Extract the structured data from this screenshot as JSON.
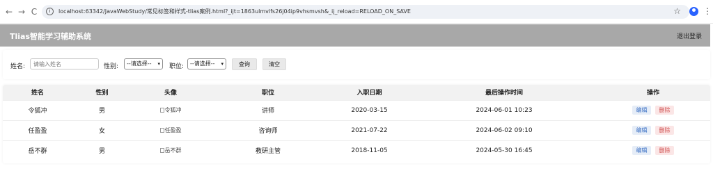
{
  "browser": {
    "url": "localhost:63342/JavaWebStudy/常见标签和样式-tlias案例.html?_ijt=1863ulmvlfs26j04ip9vhsmvsh&_ij_reload=RELOAD_ON_SAVE",
    "back_icon": "←",
    "forward_icon": "→",
    "reload_icon": "C",
    "star_icon": "☆",
    "menu_icon": "⋮"
  },
  "header": {
    "title": "Tlias智能学习辅助系统",
    "logout": "退出登录"
  },
  "search": {
    "name_label": "姓名:",
    "name_placeholder": "请输入姓名",
    "gender_label": "性别:",
    "gender_value": "--请选择--",
    "position_label": "职位:",
    "position_value": "--请选择--",
    "query_button": "查询",
    "clear_button": "清空"
  },
  "table": {
    "columns": [
      "姓名",
      "性别",
      "头像",
      "职位",
      "入职日期",
      "最后操作时间",
      "操作"
    ],
    "rows": [
      {
        "name": "令狐冲",
        "gender": "男",
        "avatar_alt": "令狐冲",
        "position": "讲师",
        "entry_date": "2020-03-15",
        "last_op": "2024-06-01 10:23"
      },
      {
        "name": "任盈盈",
        "gender": "女",
        "avatar_alt": "任盈盈",
        "position": "咨询师",
        "entry_date": "2021-07-22",
        "last_op": "2024-06-02 09:10"
      },
      {
        "name": "岳不群",
        "gender": "男",
        "avatar_alt": "岳不群",
        "position": "教研主管",
        "entry_date": "2018-11-05",
        "last_op": "2024-05-30 16:45"
      }
    ],
    "edit_label": "编辑",
    "delete_label": "删除"
  },
  "colors": {
    "header_bg": "#a8a8a8",
    "edit_text": "#3a6fc4",
    "delete_text": "#d05050"
  }
}
